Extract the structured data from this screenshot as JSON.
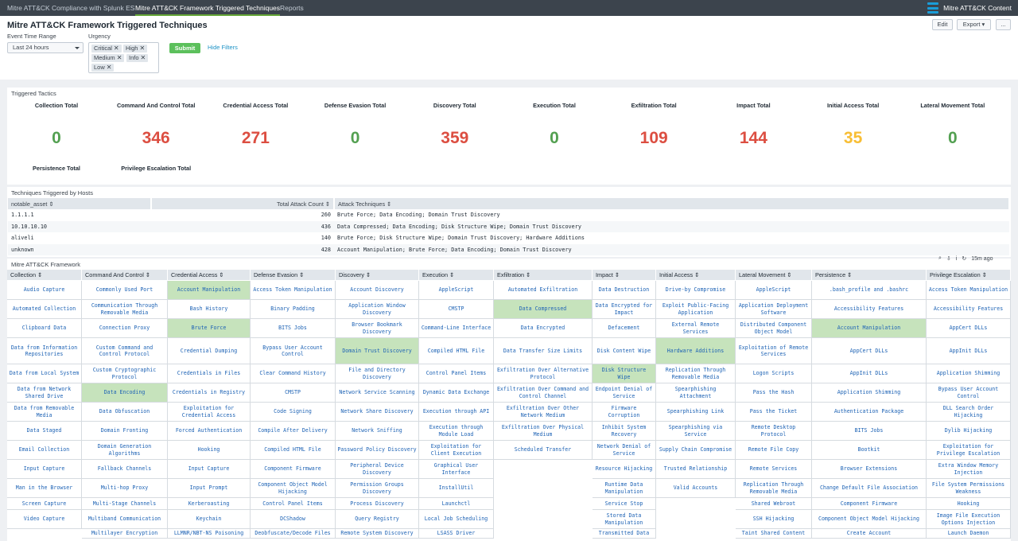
{
  "nav": {
    "items": [
      "Mitre ATT&CK Compliance with Splunk ES",
      "Mitre ATT&CK Framework Triggered Techniques",
      "Reports"
    ],
    "active_index": 1,
    "brand": "Mitre ATT&CK Content"
  },
  "page": {
    "title": "Mitre ATT&CK Framework Triggered Techniques",
    "edit": "Edit",
    "export": "Export ▾",
    "more": "..."
  },
  "filters": {
    "time_label": "Event Time Range",
    "time_value": "Last 24 hours",
    "urgency_label": "Urgency",
    "urgency_tokens": [
      "Critical",
      "High",
      "Medium",
      "Info",
      "Low"
    ],
    "submit": "Submit",
    "hide": "Hide Filters"
  },
  "tactics": {
    "title": "Triggered Tactics",
    "items": [
      {
        "label": "Collection Total",
        "value": "0",
        "color": "#53a051"
      },
      {
        "label": "Command And Control Total",
        "value": "346",
        "color": "#dc4e41"
      },
      {
        "label": "Credential Access Total",
        "value": "271",
        "color": "#dc4e41"
      },
      {
        "label": "Defense Evasion Total",
        "value": "0",
        "color": "#53a051"
      },
      {
        "label": "Discovery Total",
        "value": "359",
        "color": "#dc4e41"
      },
      {
        "label": "Execution Total",
        "value": "0",
        "color": "#53a051"
      },
      {
        "label": "Exfiltration Total",
        "value": "109",
        "color": "#dc4e41"
      },
      {
        "label": "Impact Total",
        "value": "144",
        "color": "#dc4e41"
      },
      {
        "label": "Initial Access Total",
        "value": "35",
        "color": "#f8be34"
      },
      {
        "label": "Lateral Movement Total",
        "value": "0",
        "color": "#53a051"
      },
      {
        "label": "Persistence Total",
        "value": "",
        "color": "#53a051"
      },
      {
        "label": "Privilege Escalation Total",
        "value": "",
        "color": "#53a051"
      }
    ]
  },
  "hosts": {
    "title": "Techniques Triggered by Hosts",
    "columns": [
      "notable_asset ⇕",
      "Total Attack Count ⇕",
      "Attack Techniques ⇕"
    ],
    "rows": [
      [
        "1.1.1.1",
        "260",
        "Brute Force; Data Encoding; Domain Trust Discovery"
      ],
      [
        "10.10.10.10",
        "436",
        "Data Compressed; Data Encoding; Disk Structure Wipe; Domain Trust Discovery"
      ],
      [
        "aliveli",
        "140",
        "Brute Force; Disk Structure Wipe; Domain Trust Discovery; Hardware Additions"
      ],
      [
        "unknown",
        "428",
        "Account Manipulation; Brute Force; Data Encoding; Domain Trust Discovery"
      ]
    ]
  },
  "framework": {
    "title": "Mitre ATT&CK Framework",
    "refresh": "15m ago",
    "columns": [
      {
        "name": "Collection ⇕",
        "cells": [
          "Audio Capture",
          "Automated Collection",
          "Clipboard Data",
          "Data from Information Repositories",
          "Data from Local System",
          "Data from Network Shared Drive",
          "Data from Removable Media",
          "Data Staged",
          "Email Collection",
          "Input Capture",
          "Man in the Browser",
          "Screen Capture",
          "Video Capture",
          ""
        ]
      },
      {
        "name": "Command And Control ⇕",
        "cells": [
          "Commonly Used Port",
          "Communication Through Removable Media",
          "Connection Proxy",
          "Custom Command and Control Protocol",
          "Custom Cryptographic Protocol",
          "*Data Encoding",
          "Data Obfuscation",
          "Domain Fronting",
          "Domain Generation Algorithms",
          "Fallback Channels",
          "Multi-hop Proxy",
          "Multi-Stage Channels",
          "Multiband Communication",
          "Multilayer Encryption"
        ]
      },
      {
        "name": "Credential Access ⇕",
        "cells": [
          "*Account Manipulation",
          "Bash History",
          "*Brute Force",
          "Credential Dumping",
          "Credentials in Files",
          "Credentials in Registry",
          "Exploitation for Credential Access",
          "Forced Authentication",
          "Hooking",
          "Input Capture",
          "Input Prompt",
          "Kerberoasting",
          "Keychain",
          "LLMNR/NBT-NS Poisoning"
        ]
      },
      {
        "name": "Defense Evasion ⇕",
        "cells": [
          "Access Token Manipulation",
          "Binary Padding",
          "BITS Jobs",
          "Bypass User Account Control",
          "Clear Command History",
          "CMSTP",
          "Code Signing",
          "Compile After Delivery",
          "Compiled HTML File",
          "Component Firmware",
          "Component Object Model Hijacking",
          "Control Panel Items",
          "DCShadow",
          "Deobfuscate/Decode Files"
        ]
      },
      {
        "name": "Discovery ⇕",
        "cells": [
          "Account Discovery",
          "Application Window Discovery",
          "Browser Bookmark Discovery",
          "*Domain Trust Discovery",
          "File and Directory Discovery",
          "Network Service Scanning",
          "Network Share Discovery",
          "Network Sniffing",
          "Password Policy Discovery",
          "Peripheral Device Discovery",
          "Permission Groups Discovery",
          "Process Discovery",
          "Query Registry",
          "Remote System Discovery"
        ]
      },
      {
        "name": "Execution ⇕",
        "cells": [
          "AppleScript",
          "CMSTP",
          "Command-Line Interface",
          "Compiled HTML File",
          "Control Panel Items",
          "Dynamic Data Exchange",
          "Execution through API",
          "Execution through Module Load",
          "Exploitation for Client Execution",
          "Graphical User Interface",
          "InstallUtil",
          "Launchctl",
          "Local Job Scheduling",
          "LSASS Driver"
        ]
      },
      {
        "name": "Exfiltration ⇕",
        "cells": [
          "Automated Exfiltration",
          "*Data Compressed",
          "Data Encrypted",
          "Data Transfer Size Limits",
          "Exfiltration Over Alternative Protocol",
          "Exfiltration Over Command and Control Channel",
          "Exfiltration Over Other Network Medium",
          "Exfiltration Over Physical Medium",
          "Scheduled Transfer",
          "",
          "",
          "",
          "",
          ""
        ]
      },
      {
        "name": "Impact ⇕",
        "cells": [
          "Data Destruction",
          "Data Encrypted for Impact",
          "Defacement",
          "Disk Content Wipe",
          "*Disk Structure Wipe",
          "Endpoint Denial of Service",
          "Firmware Corruption",
          "Inhibit System Recovery",
          "Network Denial of Service",
          "Resource Hijacking",
          "Runtime Data Manipulation",
          "Service Stop",
          "Stored Data Manipulation",
          "Transmitted Data"
        ]
      },
      {
        "name": "Initial Access ⇕",
        "cells": [
          "Drive-by Compromise",
          "Exploit Public-Facing Application",
          "External Remote Services",
          "*Hardware Additions",
          "Replication Through Removable Media",
          "Spearphishing Attachment",
          "Spearphishing Link",
          "Spearphishing via Service",
          "Supply Chain Compromise",
          "Trusted Relationship",
          "Valid Accounts",
          "",
          "",
          ""
        ]
      },
      {
        "name": "Lateral Movement ⇕",
        "cells": [
          "AppleScript",
          "Application Deployment Software",
          "Distributed Component Object Model",
          "Exploitation of Remote Services",
          "Logon Scripts",
          "Pass the Hash",
          "Pass the Ticket",
          "Remote Desktop Protocol",
          "Remote File Copy",
          "Remote Services",
          "Replication Through Removable Media",
          "Shared Webroot",
          "SSH Hijacking",
          "Taint Shared Content"
        ]
      },
      {
        "name": "Persistence ⇕",
        "cells": [
          ".bash_profile and .bashrc",
          "Accessibility Features",
          "*Account Manipulation",
          "AppCert DLLs",
          "AppInit DLLs",
          "Application Shimming",
          "Authentication Package",
          "BITS Jobs",
          "Bootkit",
          "Browser Extensions",
          "Change Default File Association",
          "Component Firmware",
          "Component Object Model Hijacking",
          "Create Account"
        ]
      },
      {
        "name": "Privilege Escalation ⇕",
        "cells": [
          "Access Token Manipulation",
          "Accessibility Features",
          "AppCert DLLs",
          "AppInit DLLs",
          "Application Shimming",
          "Bypass User Account Control",
          "DLL Search Order Hijacking",
          "Dylib Hijacking",
          "Exploitation for Privilege Escalation",
          "Extra Window Memory Injection",
          "File System Permissions Weakness",
          "Hooking",
          "Image File Execution Options Injection",
          "Launch Daemon"
        ]
      }
    ]
  }
}
